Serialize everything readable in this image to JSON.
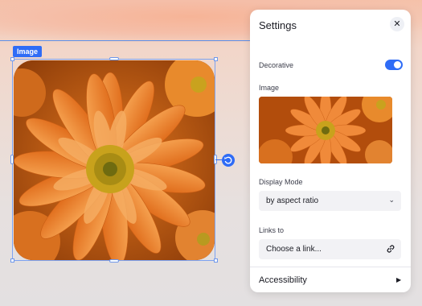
{
  "canvas": {
    "element_tag": "Image",
    "rotate_icon": "rotate-icon"
  },
  "settings": {
    "title": "Settings",
    "close_icon": "close-icon",
    "decorative_label": "Decorative",
    "decorative_on": true,
    "image_label": "Image",
    "display_mode_label": "Display Mode",
    "display_mode_value": "by aspect ratio",
    "links_to_label": "Links to",
    "link_placeholder": "Choose a link...",
    "link_icon": "link-icon",
    "accessibility_label": "Accessibility",
    "accessibility_arrow": "▶"
  },
  "colors": {
    "accent": "#2f6cf6",
    "petal": "#f08a3a",
    "center": "#b8a21a"
  }
}
